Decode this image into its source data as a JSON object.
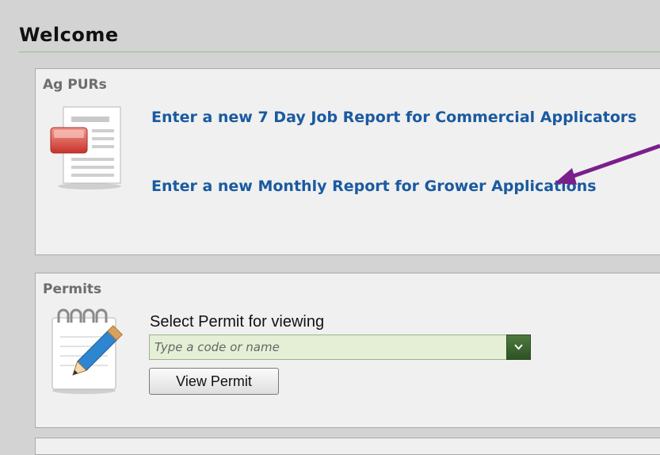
{
  "page": {
    "title": "Welcome"
  },
  "ag_purs": {
    "heading": "Ag PURs",
    "links": [
      {
        "label": "Enter a new 7 Day Job Report for Commercial Applicators",
        "icon": "report-icon"
      },
      {
        "label": "Enter a new Monthly Report for Grower Applications"
      }
    ]
  },
  "permits": {
    "heading": "Permits",
    "select_label": "Select Permit for viewing",
    "search": {
      "placeholder": "Type a code or name",
      "value": ""
    },
    "view_button_label": "View Permit",
    "icon": "notepad-pencil-icon"
  },
  "annotation": {
    "color": "#7b1f8c",
    "points_to": "Enter a new Monthly Report for Grower Applications"
  },
  "colors": {
    "link": "#1a5aa0",
    "panel_bg": "#f0f0f0",
    "page_bg": "#d3d3d3",
    "heading_gray": "#6d6d6d",
    "combo_bg": "#e4efd6",
    "combo_button": "#3c6630"
  }
}
